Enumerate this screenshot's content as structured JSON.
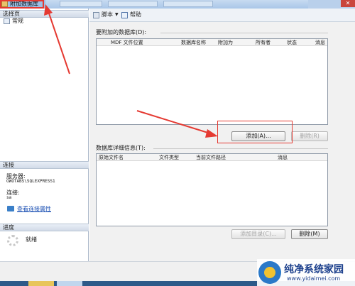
{
  "window": {
    "title": "附加数据库"
  },
  "left_pane": {
    "select_page_header": "选择页",
    "pages": [
      {
        "label": "常规",
        "icon": "general-page-icon"
      }
    ],
    "connection_header": "连接",
    "server_label": "服务器:",
    "server_value": "GWOTABS\\SQLEXPRESS1",
    "conn_label": "连接:",
    "conn_value": "sa",
    "view_conn_props_link": "查看连接属性",
    "progress_header": "进度",
    "progress_status": "就绪"
  },
  "toolbar": {
    "script_label": "脚本",
    "help_label": "帮助"
  },
  "attach_section": {
    "group_label": "要附加的数据库(D):",
    "columns": [
      "MDF 文件位置",
      "数据库名称",
      "附加为",
      "所有者",
      "状态",
      "消息"
    ],
    "add_button": "添加(A)...",
    "remove_button": "删除(R)"
  },
  "details_section": {
    "group_label": "数据库详细信息(T):",
    "columns": [
      "原始文件名",
      "文件类型",
      "当前文件路径",
      "消息"
    ],
    "add_catalog_button": "添加目录(C)...",
    "remove_button": "删除(M)"
  },
  "watermark": {
    "brand": "纯净系统家园",
    "url": "www.yidaimei.com"
  },
  "colors": {
    "annotation": "#e53a32",
    "title_bar": "#9cc0e6",
    "accent": "#2b79c8"
  }
}
